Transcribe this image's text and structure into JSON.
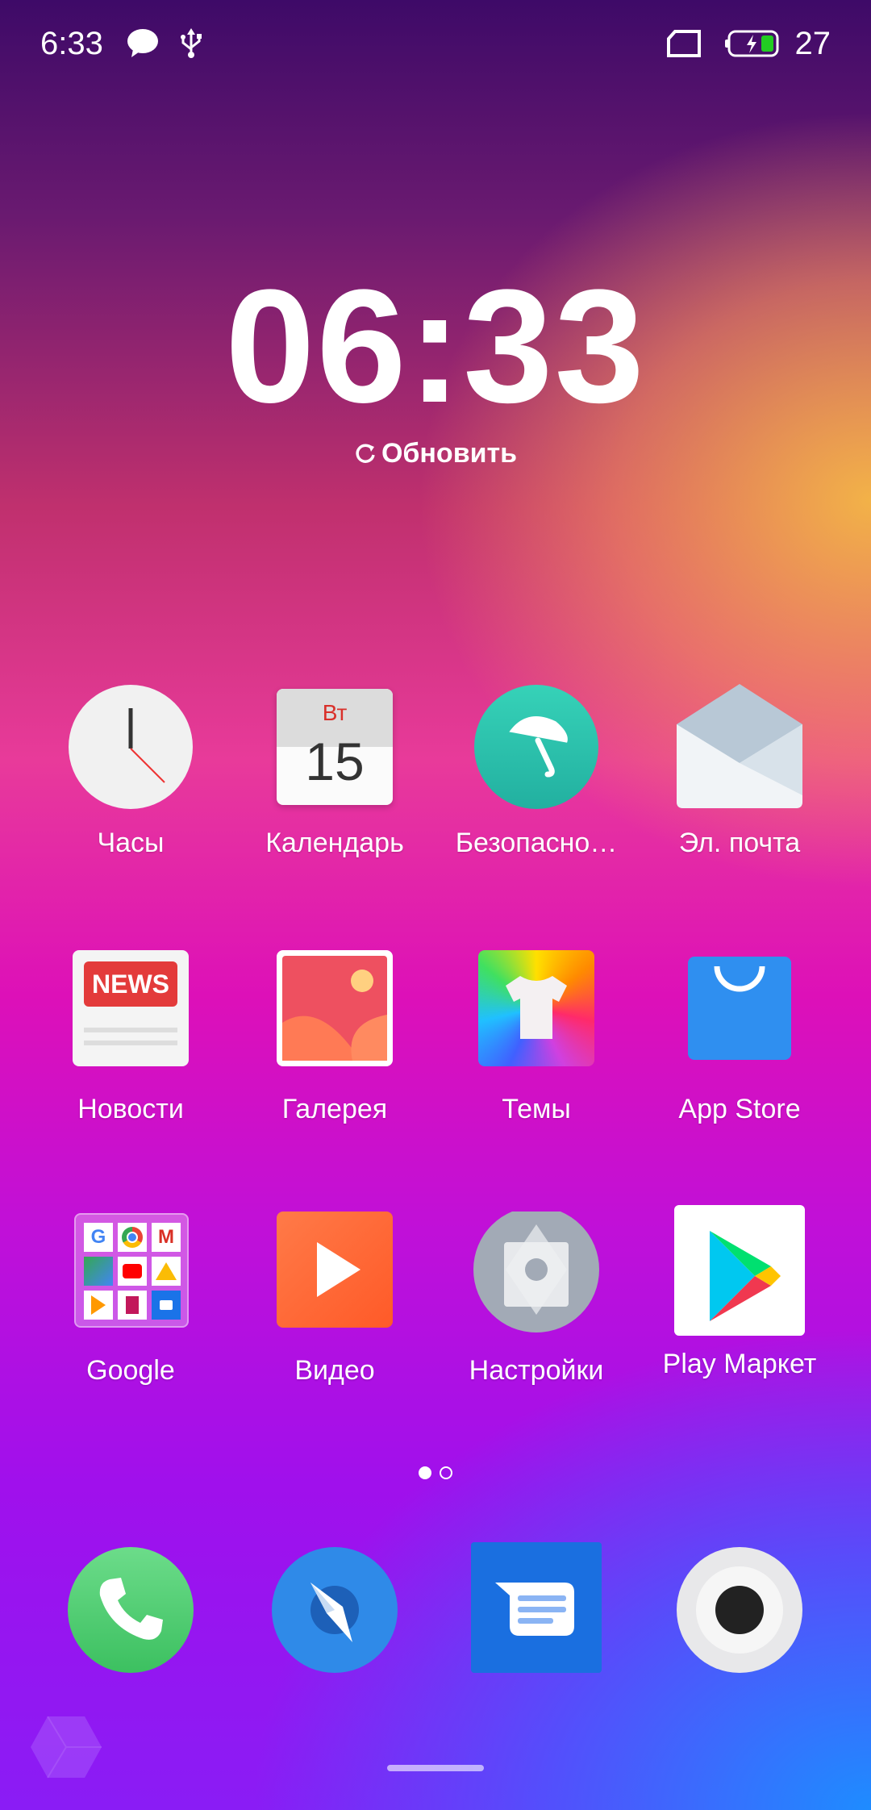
{
  "status_bar": {
    "time": "6:33",
    "battery_level": "27",
    "icons": [
      "message-icon",
      "usb-icon",
      "sim-icon",
      "battery-charging-icon"
    ]
  },
  "clock": {
    "time": "06:33",
    "refresh_label": "Обновить"
  },
  "apps": [
    {
      "label": "Часы",
      "icon": "clock-icon"
    },
    {
      "label": "Календарь",
      "icon": "calendar-icon",
      "weekday": "Вт",
      "day": "15"
    },
    {
      "label": "Безопасно…",
      "icon": "security-umbrella-icon"
    },
    {
      "label": "Эл. почта",
      "icon": "email-icon"
    },
    {
      "label": "Новости",
      "icon": "news-icon",
      "badge": "NEWS"
    },
    {
      "label": "Галерея",
      "icon": "gallery-icon"
    },
    {
      "label": "Темы",
      "icon": "themes-icon"
    },
    {
      "label": "App Store",
      "icon": "app-store-icon"
    },
    {
      "label": "Google",
      "icon": "google-folder-icon"
    },
    {
      "label": "Видео",
      "icon": "video-icon"
    },
    {
      "label": "Настройки",
      "icon": "settings-icon"
    },
    {
      "label": "Play Маркет",
      "icon": "play-store-icon"
    }
  ],
  "page_indicator": {
    "pages": 2,
    "current": 1
  },
  "dock": [
    {
      "icon": "phone-icon"
    },
    {
      "icon": "browser-icon"
    },
    {
      "icon": "messages-icon"
    },
    {
      "icon": "camera-icon"
    }
  ],
  "colors": {
    "battery_fill": "#22cc22",
    "video": "#ff6a3a",
    "appstore": "#2f8ff0"
  }
}
